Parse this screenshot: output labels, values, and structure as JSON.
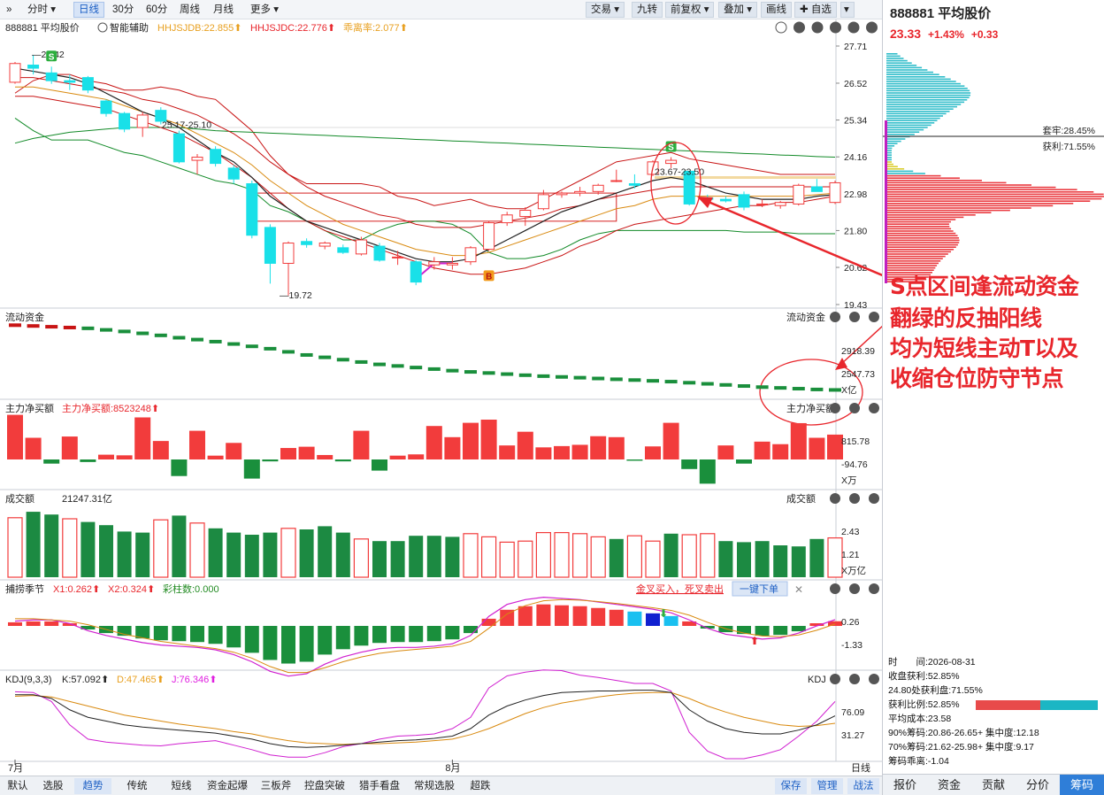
{
  "toolbar": {
    "expand_glyph": "»",
    "intervals": [
      "分时",
      "日线",
      "30分",
      "60分",
      "周线",
      "月线",
      "更多"
    ],
    "active_interval": "日线",
    "right_buttons": [
      "交易",
      "九转",
      "前复权",
      "叠加",
      "画线",
      "自选"
    ]
  },
  "header": {
    "stock": "888881 平均股价",
    "assist": "智能辅助",
    "indicators": [
      {
        "text": "HHJSJDB:22.855",
        "color": "#e8a020"
      },
      {
        "text": "HHJSJDC:22.776",
        "color": "#e8262c"
      },
      {
        "text": "乖离率:2.077",
        "color": "#e8a020"
      }
    ]
  },
  "right_panel": {
    "code": "888881 平均股价",
    "price": "23.33",
    "change_pct": "+1.43%",
    "change": "+0.33",
    "trapped_label": "套牢:28.45%",
    "profit_label": "获利:71.55%",
    "stats": [
      "时　　间:2026-08-31",
      "收盘获利:52.85%",
      "24.80处获利盘:71.55%",
      "获利比例:52.85%",
      "平均成本:23.58",
      "90%筹码:20.86-26.65+ 集中度:12.18",
      "70%筹码:21.62-25.98+ 集中度:9.17",
      "筹码乖离:-1.04"
    ],
    "profit_ratio": 0.5285,
    "tabs": [
      "报价",
      "资金",
      "贡献",
      "分价",
      "筹码"
    ],
    "active_tab": "筹码"
  },
  "bottom_tabs": [
    "默认",
    "选股",
    "趋势",
    "传统",
    "短线",
    "资金起爆",
    "三板斧",
    "控盘突破",
    "猎手看盘",
    "常规选股",
    "超跌"
  ],
  "bottom_active": "趋势",
  "bottom_right": [
    "保存",
    "管理",
    "战法"
  ],
  "annotation": [
    "S点区间逢流动资金",
    "翻绿的反抽阳线",
    "均为短线主动T以及",
    "收缩仓位防守节点"
  ],
  "chart_data": {
    "type": "candlestick",
    "ylim": [
      19.43,
      27.71
    ],
    "yticks": [
      "27.71",
      "26.52",
      "25.34",
      "24.16",
      "22.98",
      "21.80",
      "20.62",
      "19.43"
    ],
    "x_labels": [
      {
        "index": 0,
        "text": "7月"
      },
      {
        "index": 24,
        "text": "8月"
      }
    ],
    "x_axis_unit": "日线",
    "annotations": [
      "27.42",
      "19.72",
      "25.17-25.10",
      "23.67-23.50"
    ],
    "signals": [
      {
        "index": 2,
        "text": "S"
      },
      {
        "index": 36,
        "text": "S"
      },
      {
        "index": 26,
        "text": "B"
      }
    ],
    "candles": [
      {
        "o": 26.55,
        "h": 27.2,
        "l": 26.5,
        "c": 27.15
      },
      {
        "o": 27.1,
        "h": 27.42,
        "l": 26.8,
        "c": 27.0
      },
      {
        "o": 26.85,
        "h": 27.05,
        "l": 26.5,
        "c": 26.6
      },
      {
        "o": 26.6,
        "h": 26.8,
        "l": 26.3,
        "c": 26.55
      },
      {
        "o": 26.7,
        "h": 26.75,
        "l": 26.2,
        "c": 26.3
      },
      {
        "o": 25.95,
        "h": 26.0,
        "l": 25.45,
        "c": 25.55
      },
      {
        "o": 25.55,
        "h": 25.6,
        "l": 24.95,
        "c": 25.05
      },
      {
        "o": 25.1,
        "h": 25.6,
        "l": 24.8,
        "c": 25.5
      },
      {
        "o": 25.65,
        "h": 25.75,
        "l": 25.2,
        "c": 25.3
      },
      {
        "o": 24.9,
        "h": 25.0,
        "l": 23.95,
        "c": 24.0
      },
      {
        "o": 24.05,
        "h": 24.25,
        "l": 23.6,
        "c": 24.15
      },
      {
        "o": 24.4,
        "h": 24.5,
        "l": 23.85,
        "c": 23.95
      },
      {
        "o": 23.8,
        "h": 23.9,
        "l": 23.3,
        "c": 23.45
      },
      {
        "o": 23.3,
        "h": 23.4,
        "l": 21.55,
        "c": 21.65
      },
      {
        "o": 21.9,
        "h": 22.0,
        "l": 20.1,
        "c": 20.75
      },
      {
        "o": 20.75,
        "h": 21.45,
        "l": 19.72,
        "c": 21.4
      },
      {
        "o": 21.45,
        "h": 21.55,
        "l": 21.25,
        "c": 21.35
      },
      {
        "o": 21.3,
        "h": 21.45,
        "l": 21.2,
        "c": 21.4
      },
      {
        "o": 21.25,
        "h": 21.35,
        "l": 21.05,
        "c": 21.1
      },
      {
        "o": 21.05,
        "h": 21.6,
        "l": 21.0,
        "c": 21.5
      },
      {
        "o": 21.3,
        "h": 21.4,
        "l": 20.8,
        "c": 20.85
      },
      {
        "o": 20.95,
        "h": 21.15,
        "l": 20.7,
        "c": 20.95
      },
      {
        "o": 20.8,
        "h": 20.85,
        "l": 20.05,
        "c": 20.15
      },
      {
        "o": 20.7,
        "h": 20.95,
        "l": 20.55,
        "c": 20.8
      },
      {
        "o": 20.7,
        "h": 20.95,
        "l": 20.55,
        "c": 20.75
      },
      {
        "o": 20.8,
        "h": 21.3,
        "l": 20.7,
        "c": 21.25
      },
      {
        "o": 21.2,
        "h": 22.1,
        "l": 21.15,
        "c": 22.05
      },
      {
        "o": 22.05,
        "h": 22.4,
        "l": 21.95,
        "c": 22.3
      },
      {
        "o": 22.25,
        "h": 22.55,
        "l": 21.95,
        "c": 22.45
      },
      {
        "o": 22.5,
        "h": 23.1,
        "l": 22.45,
        "c": 22.95
      },
      {
        "o": 22.95,
        "h": 23.05,
        "l": 22.85,
        "c": 23.0
      },
      {
        "o": 23.0,
        "h": 23.2,
        "l": 22.9,
        "c": 23.05
      },
      {
        "o": 23.05,
        "h": 23.3,
        "l": 22.95,
        "c": 23.25
      },
      {
        "o": 23.4,
        "h": 23.75,
        "l": 23.35,
        "c": 23.4
      },
      {
        "o": 23.3,
        "h": 23.6,
        "l": 23.15,
        "c": 23.25
      },
      {
        "o": 23.6,
        "h": 24.05,
        "l": 23.55,
        "c": 24.0
      },
      {
        "o": 23.95,
        "h": 24.15,
        "l": 23.8,
        "c": 24.05
      },
      {
        "o": 23.7,
        "h": 23.7,
        "l": 22.6,
        "c": 22.65
      },
      {
        "o": 22.85,
        "h": 22.95,
        "l": 22.75,
        "c": 22.8
      },
      {
        "o": 22.8,
        "h": 22.9,
        "l": 22.7,
        "c": 22.75
      },
      {
        "o": 22.95,
        "h": 23.05,
        "l": 22.45,
        "c": 22.55
      },
      {
        "o": 22.65,
        "h": 22.8,
        "l": 22.55,
        "c": 22.65
      },
      {
        "o": 22.6,
        "h": 22.75,
        "l": 22.5,
        "c": 22.7
      },
      {
        "o": 22.65,
        "h": 23.3,
        "l": 22.6,
        "c": 23.25
      },
      {
        "o": 23.2,
        "h": 23.45,
        "l": 23.05,
        "c": 23.05
      },
      {
        "o": 22.7,
        "h": 23.4,
        "l": 22.65,
        "c": 23.33
      }
    ],
    "ma_black": [
      27.0,
      26.9,
      26.8,
      26.7,
      26.5,
      26.2,
      25.9,
      25.6,
      25.4,
      25.1,
      24.7,
      24.3,
      24.0,
      23.5,
      22.9,
      22.5,
      22.1,
      21.9,
      21.7,
      21.5,
      21.3,
      21.1,
      20.9,
      20.8,
      20.8,
      20.9,
      21.2,
      21.5,
      21.8,
      22.1,
      22.4,
      22.6,
      22.8,
      23.0,
      23.2,
      23.4,
      23.5,
      23.4,
      23.2,
      23.0,
      22.9,
      22.8,
      22.8,
      22.8,
      22.9,
      22.95
    ],
    "ma_orange": [
      26.4,
      26.4,
      26.3,
      26.2,
      26.1,
      26.0,
      25.8,
      25.6,
      25.4,
      25.2,
      24.9,
      24.6,
      24.3,
      23.9,
      23.4,
      23.0,
      22.6,
      22.3,
      22.0,
      21.8,
      21.6,
      21.4,
      21.2,
      21.1,
      21.0,
      21.0,
      21.1,
      21.3,
      21.5,
      21.7,
      21.9,
      22.1,
      22.3,
      22.5,
      22.6,
      22.8,
      22.9,
      22.9,
      22.9,
      22.9,
      22.9,
      22.9,
      22.9,
      22.9,
      22.95,
      23.0
    ],
    "band_upper": [
      26.7,
      26.7,
      26.6,
      26.5,
      26.4,
      26.3,
      26.2,
      26.0,
      25.9,
      25.7,
      25.5,
      25.2,
      24.9,
      24.5,
      24.0,
      23.6,
      23.2,
      22.9,
      22.7,
      22.5,
      22.3,
      22.2,
      22.0,
      21.9,
      21.9,
      21.9,
      22.0,
      22.1,
      22.2,
      22.3,
      22.5,
      22.6,
      22.8,
      22.9,
      23.0,
      23.1,
      23.2,
      23.2,
      23.2,
      23.2,
      23.2,
      23.2,
      23.2,
      23.2,
      23.2,
      23.2
    ],
    "band_lower": [
      26.1,
      26.1,
      26.0,
      25.9,
      25.8,
      25.7,
      25.5,
      25.3,
      25.1,
      24.9,
      24.6,
      24.3,
      23.9,
      23.5,
      23.0,
      22.5,
      22.1,
      21.8,
      21.6,
      21.4,
      21.2,
      21.0,
      20.8,
      20.6,
      20.5,
      20.4,
      20.4,
      20.5,
      20.6,
      20.8,
      21.0,
      21.3,
      21.5,
      21.8,
      22.0,
      22.1,
      22.2,
      22.3,
      22.4,
      22.5,
      22.6,
      22.6,
      22.7,
      22.7,
      22.8,
      22.9
    ],
    "ma_green": [
      24.6,
      24.75,
      24.85,
      24.95,
      25.0,
      25.05,
      25.1,
      25.1,
      25.1,
      25.1,
      25.05,
      25.0,
      24.97,
      24.95,
      24.92,
      24.9,
      24.87,
      24.85,
      24.82,
      24.8,
      24.77,
      24.75,
      24.72,
      24.7,
      24.67,
      24.65,
      24.62,
      24.6,
      24.57,
      24.55,
      24.52,
      24.5,
      24.47,
      24.45,
      24.42,
      24.4,
      24.37,
      24.35,
      24.32,
      24.3,
      24.27,
      24.25,
      24.22,
      24.2,
      24.17,
      24.15
    ],
    "env_upper": [
      26.2,
      26.6,
      26.8,
      26.8,
      26.6,
      26.5,
      26.3,
      26.3,
      26.4,
      26.3,
      26.1,
      26.0,
      25.5,
      25.0,
      24.2,
      23.6,
      23.3,
      23.3,
      23.3,
      23.3,
      23.2,
      22.9,
      22.8,
      22.6,
      22.7,
      22.8,
      22.6,
      22.5,
      22.5,
      22.8,
      23.1,
      23.4,
      23.7,
      24.0,
      24.1,
      24.2,
      24.3,
      24.1,
      24.0,
      23.9,
      23.8,
      23.7,
      23.6,
      23.6,
      23.6,
      23.6
    ],
    "env_lower": [
      25.4,
      25.0,
      24.7,
      24.7,
      24.7,
      24.5,
      24.3,
      24.2,
      24.0,
      23.8,
      23.6,
      23.4,
      23.3,
      23.1,
      22.6,
      22.4,
      22.1,
      21.8,
      21.5,
      21.5,
      21.8,
      22.0,
      22.1,
      22.1,
      22.0,
      21.7,
      21.1,
      20.9,
      20.9,
      21.0,
      21.2,
      21.5,
      21.7,
      21.8,
      21.8,
      21.8,
      21.8,
      21.8,
      21.8,
      21.8,
      21.75,
      21.75,
      21.75,
      21.7,
      21.7,
      21.7
    ],
    "red_box": {
      "start": 13,
      "end": 33,
      "high": 23.0,
      "low": 22.1
    },
    "flow": {
      "title": "流动资金",
      "yticks": [
        "2918.39",
        "2547.73"
      ],
      "unit": "X亿",
      "values": [
        3050,
        3045,
        3040,
        3035,
        3030,
        3020,
        3010,
        2998,
        2985,
        2970,
        2958,
        2945,
        2930,
        2915,
        2900,
        2880,
        2860,
        2845,
        2830,
        2815,
        2800,
        2790,
        2780,
        2770,
        2760,
        2752,
        2745,
        2738,
        2731,
        2725,
        2720,
        2715,
        2710,
        2705,
        2700,
        2695,
        2690,
        2683,
        2676,
        2669,
        2662,
        2655,
        2650,
        2645,
        2640,
        2637
      ],
      "colors": [
        "r",
        "r",
        "r",
        "r",
        "g",
        "g",
        "g",
        "g",
        "g",
        "g",
        "g",
        "g",
        "g",
        "g",
        "g",
        "g",
        "g",
        "g",
        "g",
        "g",
        "g",
        "g",
        "g",
        "g",
        "g",
        "g",
        "g",
        "g",
        "g",
        "g",
        "g",
        "g",
        "g",
        "g",
        "g",
        "g",
        "g",
        "g",
        "g",
        "g",
        "g",
        "g",
        "g",
        "g",
        "g",
        "g"
      ]
    },
    "mainflow": {
      "title": "主力净买额",
      "value_label": "主力净买额:8523248",
      "yticks": [
        "815.78",
        "-94.76"
      ],
      "unit": "X万",
      "values": [
        1400,
        680,
        -130,
        720,
        -80,
        150,
        130,
        1320,
        580,
        -520,
        900,
        120,
        520,
        -600,
        -60,
        360,
        400,
        140,
        -60,
        900,
        -350,
        120,
        160,
        1050,
        700,
        1150,
        1250,
        440,
        870,
        380,
        420,
        460,
        730,
        700,
        -40,
        410,
        1150,
        -300,
        -760,
        440,
        -130,
        560,
        480,
        1140,
        680,
        780
      ]
    },
    "turnover": {
      "title": "成交额",
      "value_label": "21247.31亿",
      "yticks": [
        "2.43",
        "1.21"
      ],
      "unit": "X万亿",
      "values": [
        2.8,
        3.08,
        2.95,
        2.75,
        2.6,
        2.45,
        2.15,
        2.1,
        2.7,
        2.9,
        2.55,
        2.3,
        2.1,
        2.0,
        2.1,
        2.3,
        2.25,
        2.4,
        2.1,
        1.8,
        1.7,
        1.7,
        1.95,
        1.95,
        1.9,
        2.05,
        1.9,
        1.65,
        1.7,
        2.1,
        2.1,
        2.05,
        1.9,
        1.8,
        1.95,
        1.7,
        2.05,
        2.0,
        2.05,
        1.7,
        1.65,
        1.7,
        1.5,
        1.45,
        1.8,
        1.85
      ],
      "colors": [
        "r",
        "g",
        "g",
        "r",
        "g",
        "g",
        "g",
        "g",
        "r",
        "g",
        "r",
        "g",
        "g",
        "g",
        "g",
        "r",
        "g",
        "g",
        "g",
        "r",
        "g",
        "g",
        "g",
        "g",
        "g",
        "r",
        "r",
        "r",
        "r",
        "r",
        "r",
        "r",
        "r",
        "g",
        "r",
        "r",
        "g",
        "r",
        "r",
        "g",
        "g",
        "g",
        "g",
        "g",
        "g",
        "r"
      ]
    },
    "capture": {
      "title": "捕捞季节",
      "legend": [
        {
          "text": "X1:0.262",
          "color": "#e8262c"
        },
        {
          "text": "X2:0.324",
          "color": "#e8262c"
        },
        {
          "text": "彩柱数:0.000",
          "color": "#228b22"
        }
      ],
      "signal_label": "金叉买入，死叉卖出",
      "signal_button": "一键下单",
      "yticks": [
        "0.26",
        "-1.33"
      ],
      "x1": [
        0.2,
        0.25,
        0.25,
        0.1,
        -0.2,
        -0.4,
        -0.55,
        -0.7,
        -0.8,
        -0.85,
        -0.9,
        -1.0,
        -1.2,
        -1.5,
        -1.9,
        -2.1,
        -2.0,
        -1.6,
        -1.3,
        -1.1,
        -0.95,
        -0.9,
        -0.9,
        -0.85,
        -0.75,
        -0.4,
        0.4,
        0.9,
        1.1,
        1.2,
        1.15,
        1.1,
        1.0,
        0.9,
        0.8,
        0.7,
        0.55,
        0.25,
        -0.1,
        -0.35,
        -0.45,
        -0.55,
        -0.5,
        -0.3,
        0.0,
        0.26
      ],
      "x2": [
        0.3,
        0.3,
        0.25,
        0.2,
        0.05,
        -0.15,
        -0.35,
        -0.5,
        -0.65,
        -0.75,
        -0.85,
        -0.95,
        -1.1,
        -1.35,
        -1.7,
        -1.95,
        -1.95,
        -1.75,
        -1.5,
        -1.3,
        -1.15,
        -1.05,
        -0.98,
        -0.92,
        -0.85,
        -0.65,
        -0.1,
        0.5,
        0.85,
        1.05,
        1.1,
        1.08,
        1.02,
        0.94,
        0.85,
        0.76,
        0.65,
        0.45,
        0.15,
        -0.12,
        -0.3,
        -0.42,
        -0.45,
        -0.38,
        -0.18,
        0.08
      ]
    },
    "kdj": {
      "title": "KDJ(9,3,3)",
      "legend": [
        {
          "text": "K:57.092",
          "color": "#222"
        },
        {
          "text": "D:47.465",
          "color": "#e8a020"
        },
        {
          "text": "J:76.346",
          "color": "#e020e0"
        }
      ],
      "yticks": [
        "76.09",
        "31.27"
      ],
      "k": [
        85,
        85,
        80,
        65,
        55,
        50,
        45,
        42,
        40,
        38,
        36,
        34,
        30,
        26,
        20,
        16,
        15,
        16,
        18,
        20,
        22,
        24,
        25,
        27,
        30,
        40,
        58,
        70,
        78,
        84,
        88,
        89,
        90,
        90,
        91,
        91,
        88,
        65,
        50,
        40,
        35,
        33,
        33,
        38,
        45,
        57
      ],
      "d": [
        83,
        84,
        82,
        76,
        70,
        64,
        58,
        54,
        50,
        46,
        43,
        40,
        36,
        33,
        28,
        24,
        21,
        20,
        19,
        20,
        20,
        21,
        22,
        24,
        26,
        32,
        40,
        50,
        60,
        68,
        74,
        78,
        82,
        85,
        87,
        88,
        88,
        80,
        70,
        62,
        55,
        50,
        45,
        43,
        44,
        47
      ],
      "j": [
        89,
        88,
        76,
        45,
        26,
        22,
        20,
        18,
        17,
        20,
        22,
        24,
        18,
        12,
        5,
        2,
        2,
        8,
        16,
        20,
        26,
        30,
        31,
        33,
        40,
        55,
        94,
        110,
        115,
        118,
        117,
        111,
        108,
        104,
        100,
        100,
        90,
        35,
        10,
        0,
        0,
        5,
        12,
        30,
        50,
        76
      ]
    }
  }
}
